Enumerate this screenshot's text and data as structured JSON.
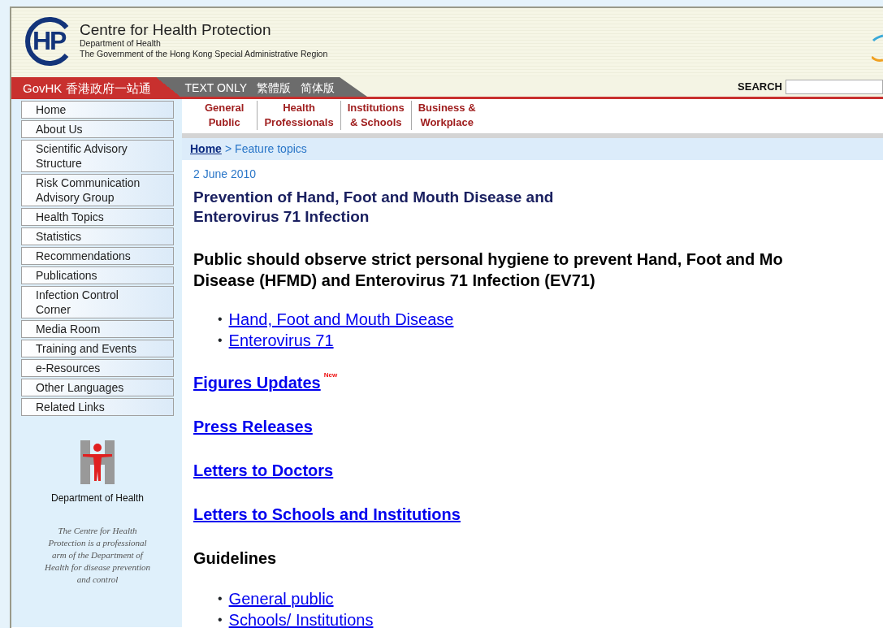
{
  "header": {
    "logo_text": "HP",
    "title": "Centre for Health Protection",
    "department": "Department of Health",
    "government": "The Government of the Hong Kong Special Administrative Region"
  },
  "top_bar": {
    "govhk": "GovHK 香港政府一站通",
    "options": [
      "TEXT ONLY",
      "繁體版",
      "简体版"
    ],
    "search_label": "SEARCH"
  },
  "audience_tabs": [
    {
      "lines": [
        "General",
        "Public"
      ]
    },
    {
      "lines": [
        "Health",
        "Professionals"
      ]
    },
    {
      "lines": [
        "Institutions",
        "& Schools"
      ]
    },
    {
      "lines": [
        "Business &",
        "Workplace"
      ]
    }
  ],
  "breadcrumb": {
    "home": "Home",
    "separator": ">",
    "current": "Feature topics"
  },
  "sidebar": {
    "items": [
      {
        "lines": [
          "Home"
        ]
      },
      {
        "lines": [
          "About Us"
        ]
      },
      {
        "lines": [
          "Scientific Advisory",
          "Structure"
        ]
      },
      {
        "lines": [
          "Risk Communication",
          "Advisory Group"
        ]
      },
      {
        "lines": [
          "Health Topics"
        ]
      },
      {
        "lines": [
          "Statistics"
        ]
      },
      {
        "lines": [
          "Recommendations"
        ]
      },
      {
        "lines": [
          "Publications"
        ]
      },
      {
        "lines": [
          "Infection Control",
          "Corner"
        ]
      },
      {
        "lines": [
          "Media Room"
        ]
      },
      {
        "lines": [
          "Training and Events"
        ]
      },
      {
        "lines": [
          "e-Resources"
        ]
      },
      {
        "lines": [
          "Other Languages"
        ]
      },
      {
        "lines": [
          "Related Links"
        ]
      }
    ],
    "emblem_label": "Department of Health",
    "note": "The Centre for Health Protection is a professional arm of the Department of Health for disease prevention and control"
  },
  "content": {
    "date": "2 June 2010",
    "title_lines": [
      "Prevention of Hand, Foot and Mouth Disease and",
      "Enterovirus 71 Infection"
    ],
    "headline_lines": [
      "Public should observe strict personal hygiene to prevent Hand, Foot and Mo",
      "Disease (HFMD) and Enterovirus 71 Infection (EV71)"
    ],
    "sections": [
      {
        "kind": "bullets",
        "marker": "•",
        "items": [
          "Hand, Foot and Mouth Disease",
          "Enterovirus 71"
        ]
      },
      {
        "kind": "link_heading",
        "text": "Figures Updates",
        "badge": "New"
      },
      {
        "kind": "link_heading",
        "text": "Press Releases"
      },
      {
        "kind": "link_heading",
        "text": "Letters to Doctors"
      },
      {
        "kind": "link_heading",
        "text": "Letters to Schools and Institutions"
      },
      {
        "kind": "heading",
        "text": "Guidelines"
      },
      {
        "kind": "bullets",
        "marker": "•",
        "items": [
          "General public",
          "Schools/ Institutions"
        ]
      }
    ]
  }
}
